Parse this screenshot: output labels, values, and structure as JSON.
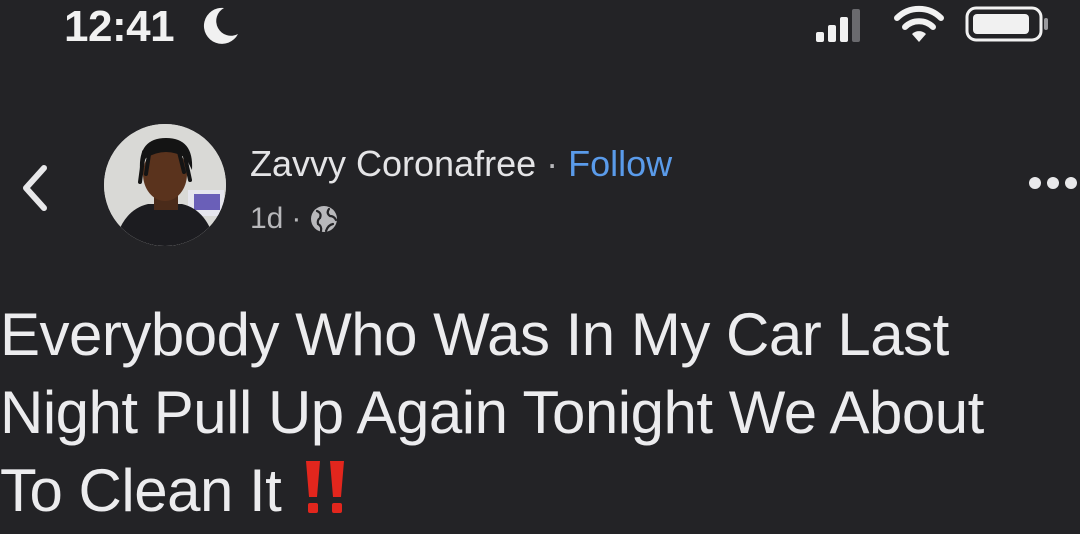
{
  "status_bar": {
    "time": "12:41",
    "icons": [
      "moon-icon",
      "cellular-signal-icon",
      "wifi-icon",
      "battery-icon"
    ]
  },
  "post": {
    "author_name": "Zavvy Coronafree",
    "separator": "·",
    "follow_label": "Follow",
    "timestamp": "1d",
    "meta_separator": "·",
    "audience_icon": "globe-icon",
    "text_lines": [
      "Everybody Who Was In My Car Last",
      "Night Pull Up Again Tonight We About",
      "To Clean It"
    ],
    "emoji": "‼️"
  },
  "colors": {
    "background": "#232326",
    "follow_link": "#5a9bea",
    "emoji_red": "#e2261d"
  }
}
